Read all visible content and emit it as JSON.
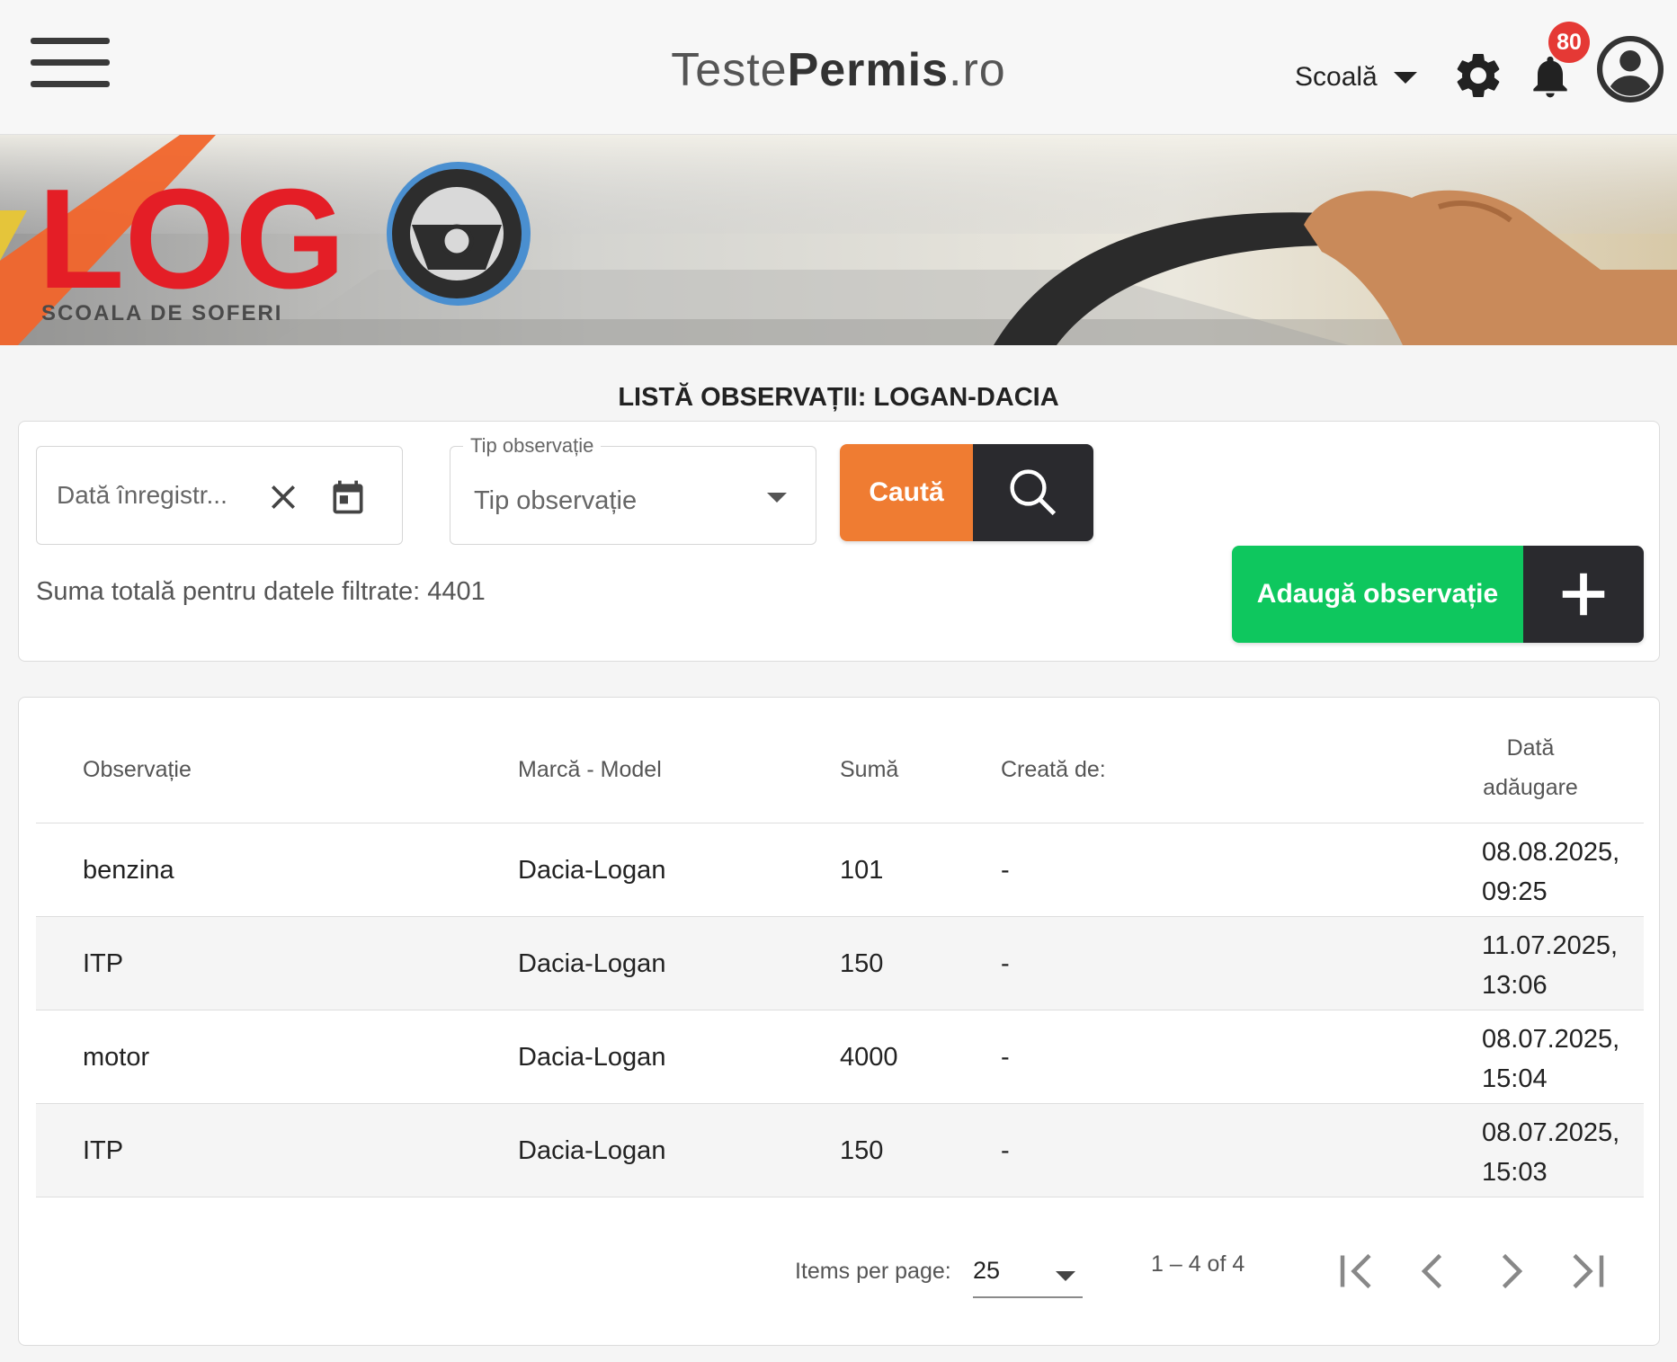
{
  "header": {
    "brand_part1": "Teste",
    "brand_part2": "Permis",
    "brand_part3": ".ro",
    "role_label": "Scoală",
    "notification_count": "80",
    "icons": {
      "menu": "hamburger-menu-icon",
      "role_dropdown": "caret-down-icon",
      "settings": "gear-icon",
      "notifications": "bell-icon",
      "account": "account-circle-icon"
    }
  },
  "banner": {
    "logo_text": "LOG",
    "tagline": "SCOALA DE SOFERI",
    "logo_icon": "steering-wheel-icon"
  },
  "page": {
    "title": "LISTĂ OBSERVAȚII: LOGAN-DACIA"
  },
  "filters": {
    "date_placeholder": "Dată înregistr...",
    "type_label": "Tip observație",
    "type_placeholder": "Tip observație",
    "search_label": "Caută",
    "total_label": "Suma totală pentru datele filtrate:",
    "total_value": "4401",
    "add_label": "Adaugă observație",
    "icons": {
      "clear": "close-icon",
      "calendar": "calendar-icon",
      "type_dropdown": "caret-down-icon",
      "search": "search-icon",
      "add": "plus-icon"
    }
  },
  "table": {
    "columns": {
      "observatie": "Observație",
      "marca_model": "Marcă - Model",
      "suma": "Sumă",
      "creata_de": "Creată de:",
      "data_adaugare_line1": "Dată",
      "data_adaugare_line2": "adăugare"
    },
    "rows": [
      {
        "observatie": "benzina",
        "marca_model": "Dacia-Logan",
        "suma": "101",
        "creata_de": "-",
        "data_line1": "08.08.2025,",
        "data_line2": "09:25"
      },
      {
        "observatie": "ITP",
        "marca_model": "Dacia-Logan",
        "suma": "150",
        "creata_de": "-",
        "data_line1": "11.07.2025,",
        "data_line2": "13:06"
      },
      {
        "observatie": "motor",
        "marca_model": "Dacia-Logan",
        "suma": "4000",
        "creata_de": "-",
        "data_line1": "08.07.2025,",
        "data_line2": "15:04"
      },
      {
        "observatie": "ITP",
        "marca_model": "Dacia-Logan",
        "suma": "150",
        "creata_de": "-",
        "data_line1": "08.07.2025,",
        "data_line2": "15:03"
      }
    ]
  },
  "pagination": {
    "items_per_page_label": "Items per page:",
    "items_per_page_value": "25",
    "range_label": "1 – 4 of 4",
    "icons": {
      "first": "first-page-icon",
      "prev": "chevron-left-icon",
      "next": "chevron-right-icon",
      "last": "last-page-icon"
    }
  },
  "colors": {
    "search_button": "#ef7c32",
    "add_button": "#0ec75e",
    "icon_button": "#2a2a2e",
    "badge": "#e53935",
    "logo_red": "#e41e26"
  }
}
